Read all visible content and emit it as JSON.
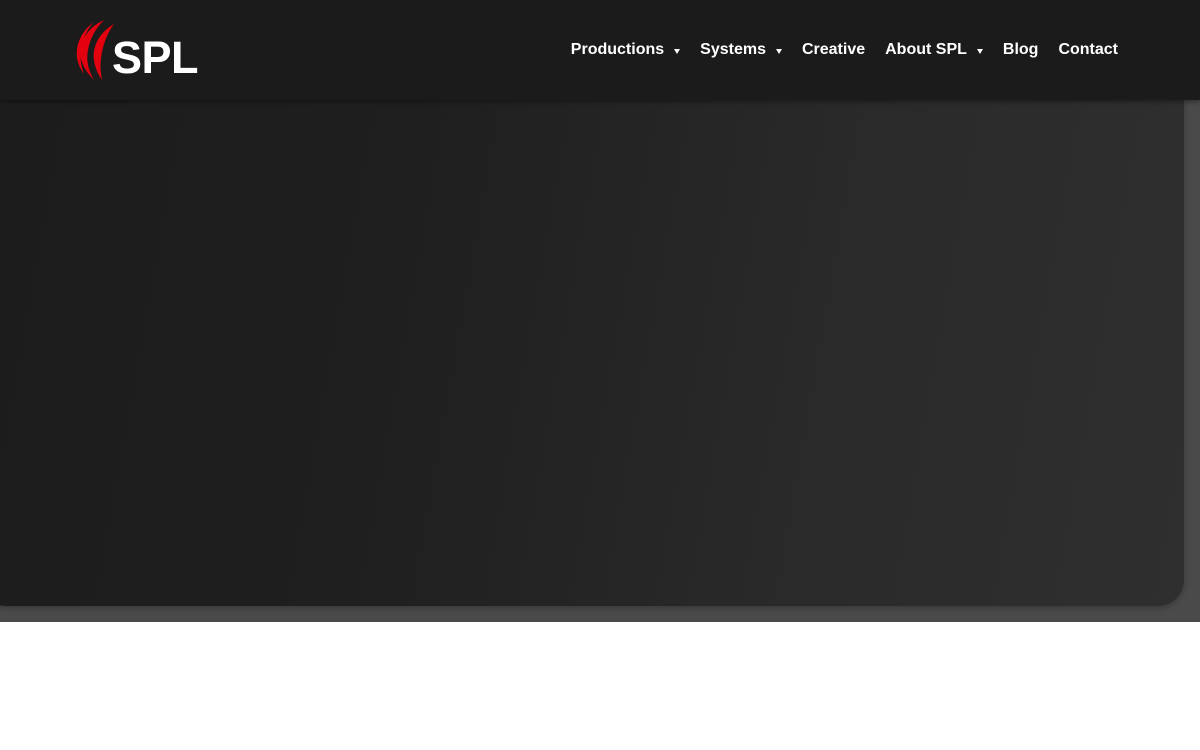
{
  "brand": {
    "logo_text": "SPL",
    "accent_color": "#e3000f",
    "logo_icon": "red-swoosh-icon"
  },
  "nav": {
    "items": [
      {
        "label": "Productions",
        "has_dropdown": true,
        "icon": "chevron-down-icon"
      },
      {
        "label": "Systems",
        "has_dropdown": true,
        "icon": "chevron-down-icon"
      },
      {
        "label": "Creative",
        "has_dropdown": false
      },
      {
        "label": "About SPL",
        "has_dropdown": true,
        "icon": "chevron-down-icon"
      },
      {
        "label": "Blog",
        "has_dropdown": false
      },
      {
        "label": "Contact",
        "has_dropdown": false
      }
    ]
  },
  "colors": {
    "header_bg": "#1b1b1b",
    "hero_bg": "#202020",
    "band_bg": "#4a4a4a",
    "text": "#ffffff"
  }
}
